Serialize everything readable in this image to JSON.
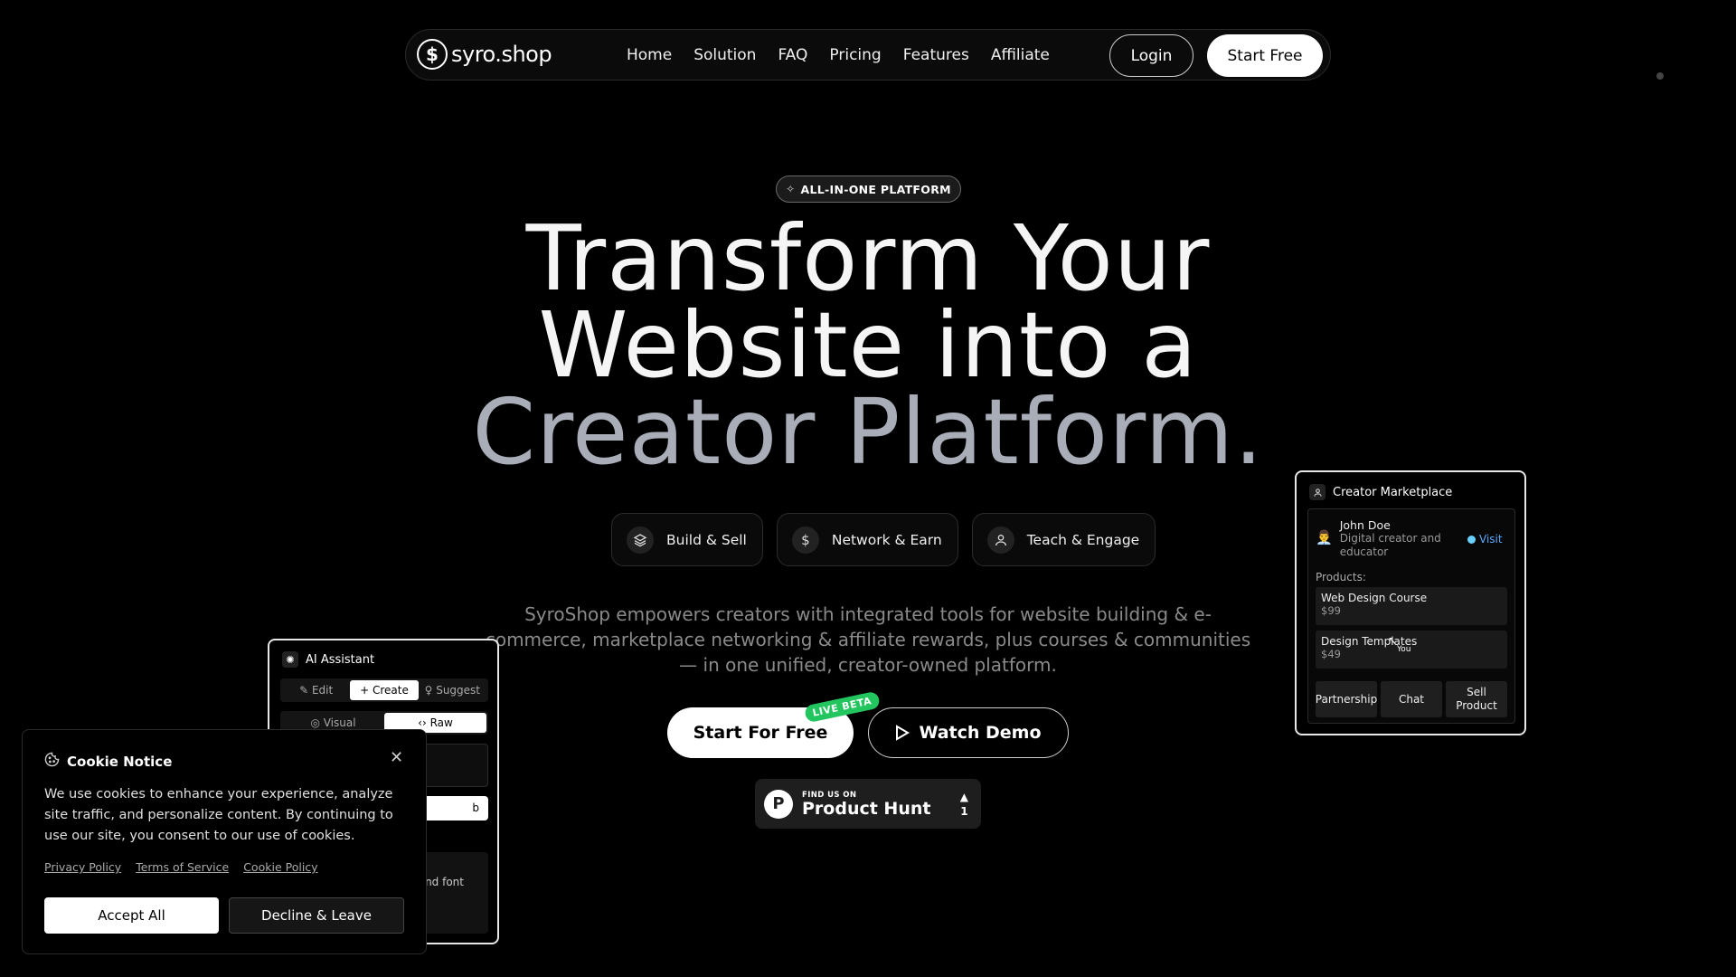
{
  "nav": {
    "logo_text": "syro.shop",
    "links": [
      "Home",
      "Solution",
      "FAQ",
      "Pricing",
      "Features",
      "Affiliate"
    ],
    "login_label": "Login",
    "start_free_label": "Start Free"
  },
  "hero": {
    "badge": "ALL-IN-ONE PLATFORM",
    "headline_line1": "Transform Your",
    "headline_line2": "Website into a",
    "headline_line3": "Creator Platform.",
    "pills": [
      {
        "label": "Build & Sell",
        "icon": "layers-icon"
      },
      {
        "label": "Network & Earn",
        "icon": "dollar-icon"
      },
      {
        "label": "Teach & Engage",
        "icon": "user-icon"
      }
    ],
    "description": "SyroShop empowers creators with integrated tools for website building & e-commerce, marketplace networking & affiliate rewards, plus courses & communities — in one unified, creator-owned platform.",
    "cta_start": "Start For Free",
    "live_beta": "LIVE BETA",
    "cta_demo": "Watch Demo",
    "producthunt_small": "FIND US ON",
    "producthunt_big": "Product Hunt",
    "producthunt_votes": "1"
  },
  "ai_assistant": {
    "title": "AI Assistant",
    "tabs": [
      "✎ Edit",
      "+ Create",
      "♀ Suggest"
    ],
    "active_tab": "+ Create",
    "view_tabs": [
      "◎ Visual",
      "‹› Raw"
    ],
    "box2_text": "b",
    "box3_text": "nd font"
  },
  "creator_marketplace": {
    "title": "Creator Marketplace",
    "user_name": "John Doe",
    "user_bio": "Digital creator and educator",
    "visit_label": "Visit",
    "products_label": "Products:",
    "products": [
      {
        "name": "Web Design Course",
        "price": "$99"
      },
      {
        "name": "Design Templates",
        "price": "$49"
      }
    ],
    "cursor_label": "You",
    "actions": [
      "Partnership",
      "Chat",
      "Sell Product"
    ]
  },
  "cookie": {
    "title": "Cookie Notice",
    "body": "We use cookies to enhance your experience, analyze site traffic, and personalize content. By continuing to use our site, you consent to our use of cookies.",
    "links": [
      "Privacy Policy",
      "Terms of Service",
      "Cookie Policy"
    ],
    "accept_label": "Accept All",
    "decline_label": "Decline & Leave"
  }
}
